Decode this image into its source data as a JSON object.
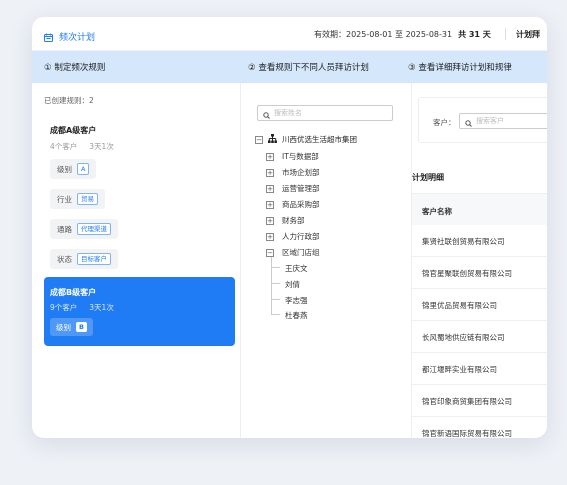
{
  "header": {
    "title": "频次计划",
    "validity": "有效期：2025-08-01 至 2025-08-31",
    "days": "共 31 天",
    "plan_cut": "计划拜"
  },
  "steps": [
    {
      "label": "① 制定频次规则"
    },
    {
      "label": "② 查看规则下不同人员拜访计划"
    },
    {
      "label": "③ 查看详细拜访计划和规律"
    }
  ],
  "left": {
    "created": "已创建规则：2",
    "rule_a": {
      "name": "成都A级客户",
      "customers": "4个客户",
      "freq": "3天1次",
      "conditions": [
        {
          "key": "级别",
          "value": "A"
        },
        {
          "key": "行业",
          "value": "贸易"
        },
        {
          "key": "通路",
          "value": "代理渠道"
        },
        {
          "key": "状态",
          "value": "目标客户"
        }
      ]
    },
    "rule_b": {
      "name": "成都B级客户",
      "customers": "9个客户",
      "freq": "3天1次",
      "condition": {
        "key": "级别",
        "value": "B"
      }
    }
  },
  "middle": {
    "search_placeholder": "搜索姓名",
    "root": "川西优选生活超市集团",
    "departments": [
      "IT与数据部",
      "市场企划部",
      "运营管理部",
      "商品采购部",
      "财务部",
      "人力行政部",
      "区域门店组"
    ],
    "people": [
      "王庆文",
      "刘倩",
      "李志强",
      "杜春燕"
    ]
  },
  "right": {
    "customer_label": "客户：",
    "customer_placeholder": "搜索客户",
    "detail_title": "计划明细",
    "column": "客户名称",
    "rows": [
      "集贤社联创贸易有限公司",
      "锦官星聚联创贸易有限公司",
      "锦里优品贸易有限公司",
      "长风蜀地供应链有限公司",
      "都江堰畔实业有限公司",
      "锦官印象商贸集团有限公司",
      "锦官新语国际贸易有限公司"
    ]
  },
  "colors": {
    "accent": "#1f7cf5",
    "step_bar": "#d4e7fb",
    "background": "#eef1f6"
  }
}
